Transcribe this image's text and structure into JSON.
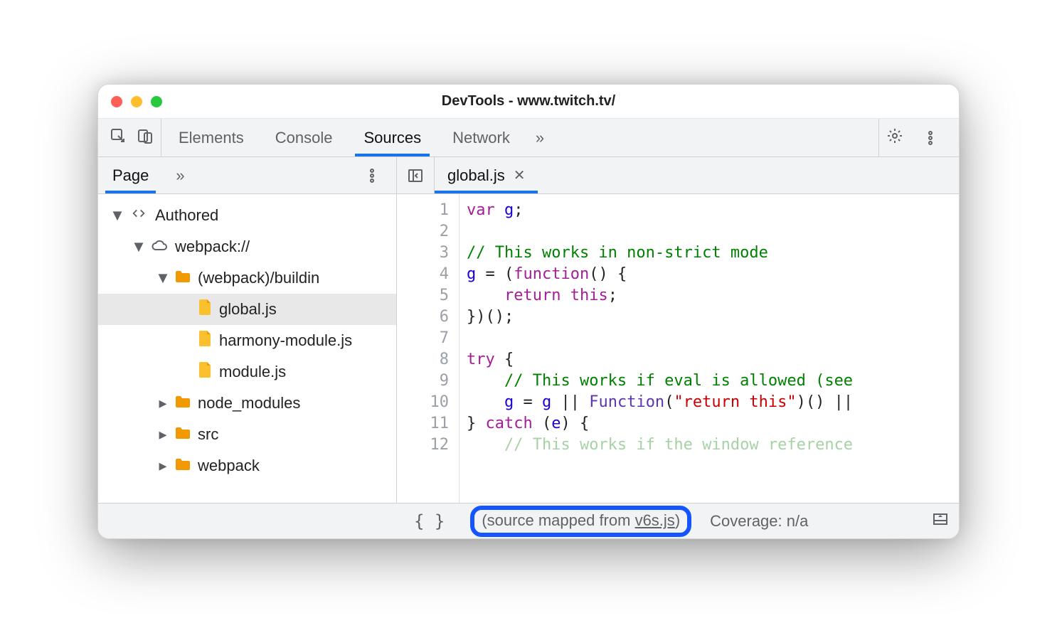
{
  "window": {
    "title": "DevTools - www.twitch.tv/"
  },
  "tabs": {
    "items": [
      {
        "label": "Elements"
      },
      {
        "label": "Console"
      },
      {
        "label": "Sources"
      },
      {
        "label": "Network"
      }
    ],
    "active_index": 2
  },
  "sidebar": {
    "subtabs": {
      "active": "Page"
    },
    "tree": {
      "root": {
        "label": "Authored"
      },
      "origin": {
        "label": "webpack://"
      },
      "buildin": {
        "label": "(webpack)/buildin"
      },
      "files": [
        {
          "label": "global.js",
          "selected": true
        },
        {
          "label": "harmony-module.js"
        },
        {
          "label": "module.js"
        }
      ],
      "folders": [
        {
          "label": "node_modules"
        },
        {
          "label": "src"
        },
        {
          "label": "webpack"
        }
      ]
    }
  },
  "open_file": {
    "tab_label": "global.js",
    "line_count": 12,
    "lines": [
      [
        [
          "kw",
          "var"
        ],
        [
          "",
          " "
        ],
        [
          "bl",
          "g"
        ],
        [
          "",
          ";"
        ]
      ],
      [
        [
          "",
          ""
        ]
      ],
      [
        [
          "cm",
          "// This works in non-strict mode"
        ]
      ],
      [
        [
          "bl",
          "g"
        ],
        [
          "",
          " = ("
        ],
        [
          "kw",
          "function"
        ],
        [
          "",
          "() {"
        ]
      ],
      [
        [
          "",
          "    "
        ],
        [
          "kw",
          "return"
        ],
        [
          "",
          " "
        ],
        [
          "kw",
          "this"
        ],
        [
          "",
          ";"
        ]
      ],
      [
        [
          "",
          "})();"
        ]
      ],
      [
        [
          "",
          ""
        ]
      ],
      [
        [
          "kw",
          "try"
        ],
        [
          "",
          " {"
        ]
      ],
      [
        [
          "",
          "    "
        ],
        [
          "cm",
          "// This works if eval is allowed (see"
        ]
      ],
      [
        [
          "",
          "    "
        ],
        [
          "bl",
          "g"
        ],
        [
          "",
          " = "
        ],
        [
          "bl",
          "g"
        ],
        [
          "",
          " || "
        ],
        [
          "fn",
          "Function"
        ],
        [
          "",
          "("
        ],
        [
          "rd",
          "\"return this\""
        ],
        [
          "",
          ")() ||"
        ]
      ],
      [
        [
          "",
          "} "
        ],
        [
          "kw",
          "catch"
        ],
        [
          "",
          " ("
        ],
        [
          "bl",
          "e"
        ],
        [
          "",
          ") {"
        ]
      ],
      [
        [
          "",
          "    "
        ],
        [
          "cm",
          "// This works if the window reference"
        ]
      ]
    ]
  },
  "statusbar": {
    "mapped_prefix": "(source mapped from ",
    "mapped_link": "v6s.js",
    "mapped_suffix": ")",
    "coverage": "Coverage: n/a"
  }
}
